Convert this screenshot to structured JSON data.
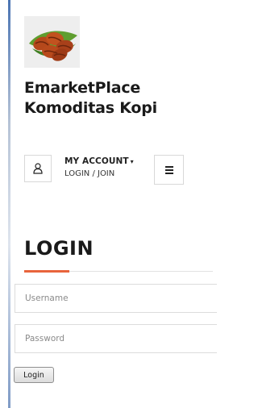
{
  "site": {
    "title_line1": "EmarketPlace",
    "title_line2": "Komoditas Kopi",
    "logo_icon": "coffee-beans-leaf-icon"
  },
  "header": {
    "user_icon": "user-icon",
    "account_title": "MY ACCOUNT",
    "account_caret": "▾",
    "account_sub": "LOGIN / JOIN",
    "menu_icon": "hamburger-menu-icon"
  },
  "login": {
    "heading": "LOGIN",
    "accent_color": "#e8643c",
    "username_placeholder": "Username",
    "password_placeholder": "Password",
    "submit_label": "Login"
  }
}
